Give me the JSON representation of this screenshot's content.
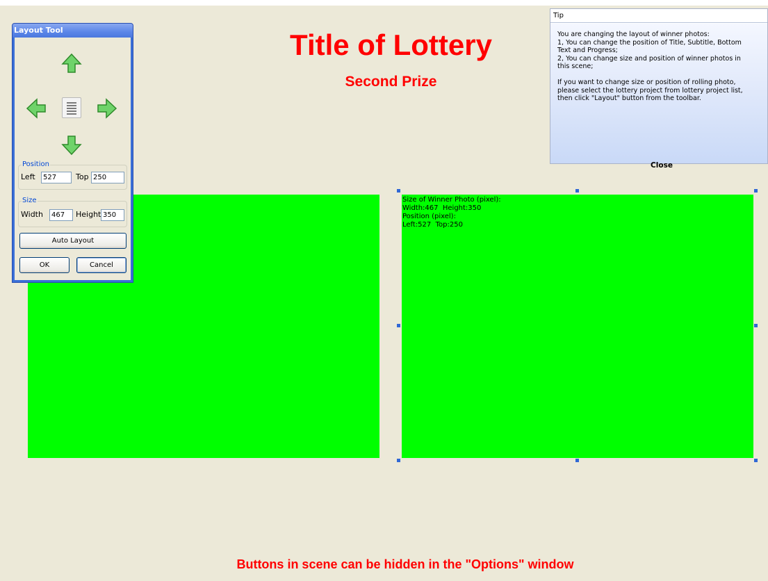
{
  "scene": {
    "title": "Title of Lottery",
    "subtitle": "Second Prize",
    "bottom_text": "Buttons in scene can be hidden in the \"Options\" window",
    "photo_info": "Size of Winner Photo (pixel):\nWidth:467  Height:350\nPosition (pixel):\nLeft:527  Top:250",
    "colors": {
      "background": "#ece9d8",
      "text": "#ff0000",
      "photo": "#00ff00",
      "handle": "#3168d5"
    }
  },
  "layout_tool": {
    "title": "Layout Tool",
    "icons": {
      "up": "arrow-up-icon",
      "down": "arrow-down-icon",
      "left": "arrow-left-icon",
      "right": "arrow-right-icon",
      "center": "align-center-icon"
    },
    "position_group": "Position",
    "left_label": "Left",
    "left_value": "527",
    "top_label": "Top",
    "top_value": "250",
    "size_group": "Size",
    "width_label": "Width",
    "width_value": "467",
    "height_label": "Height",
    "height_value": "350",
    "auto_layout_label": "Auto Layout",
    "ok_label": "OK",
    "cancel_label": "Cancel"
  },
  "tip": {
    "title": "Tip",
    "text": "You are changing the layout of winner photos:\n1, You can change the position of Title, Subtitle, Bottom\nText and Progress;\n2, You can change size and position of winner photos in\nthis scene;\n\nIf you want to change size or position of rolling photo,\nplease select the lottery project from lottery project list,\nthen click \"Layout\" button from the toolbar.",
    "close_label": "Close"
  }
}
